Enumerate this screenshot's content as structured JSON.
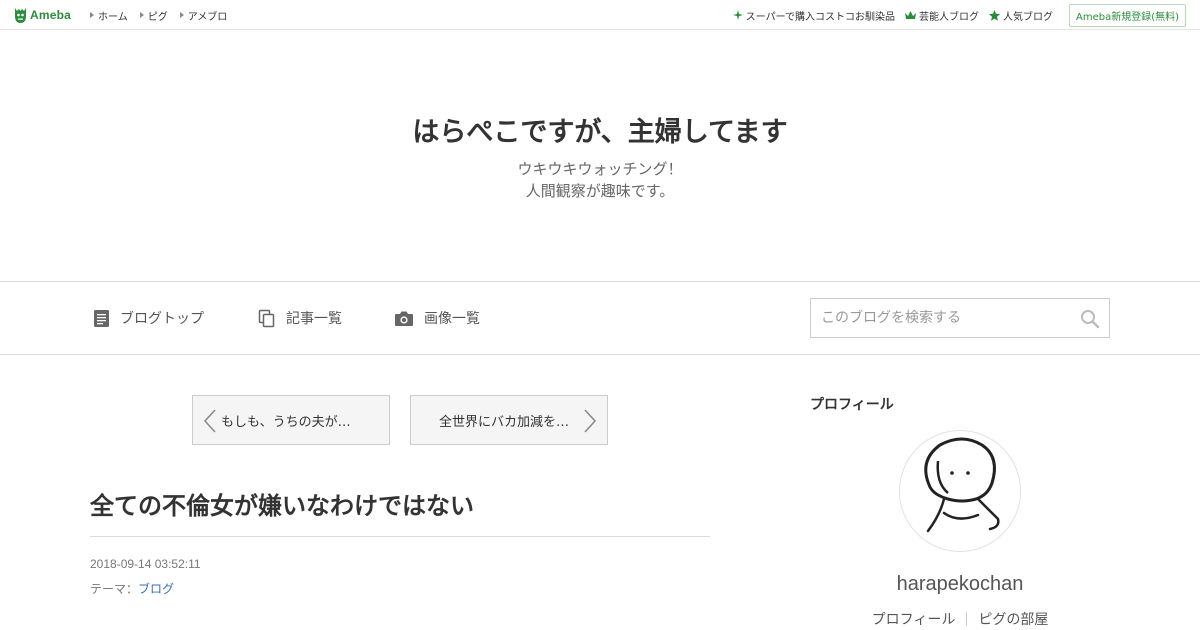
{
  "topbar": {
    "logo_text": "Ameba",
    "nav": [
      "ホーム",
      "ピグ",
      "アメブロ"
    ],
    "links": [
      {
        "label": "スーパーで購入コストコお馴染品",
        "icon": "sparkle-icon"
      },
      {
        "label": "芸能人ブログ",
        "icon": "crown-icon"
      },
      {
        "label": "人気ブログ",
        "icon": "star-icon"
      }
    ],
    "register_label": "Ameba新規登録(無料)",
    "accent_color": "#2d8c3c"
  },
  "header": {
    "title": "はらぺこですが、主婦してます",
    "description_line1": "ウキウキウォッチング！",
    "description_line2": "人間観察が趣味です。"
  },
  "nav": {
    "blog_top": "ブログトップ",
    "article_list": "記事一覧",
    "image_list": "画像一覧"
  },
  "search": {
    "placeholder": "このブログを検索する"
  },
  "pager": {
    "prev_label": "もしも、うちの夫が…",
    "next_label": "全世界にバカ加減を…"
  },
  "article": {
    "title": "全ての不倫女が嫌いなわけではない",
    "date": "2018-09-14 03:52:11",
    "theme_prefix": "テーマ：",
    "theme": "ブログ"
  },
  "sidebar": {
    "heading": "プロフィール",
    "username": "harapekochan",
    "links": [
      "プロフィール",
      "ピグの部屋"
    ]
  }
}
